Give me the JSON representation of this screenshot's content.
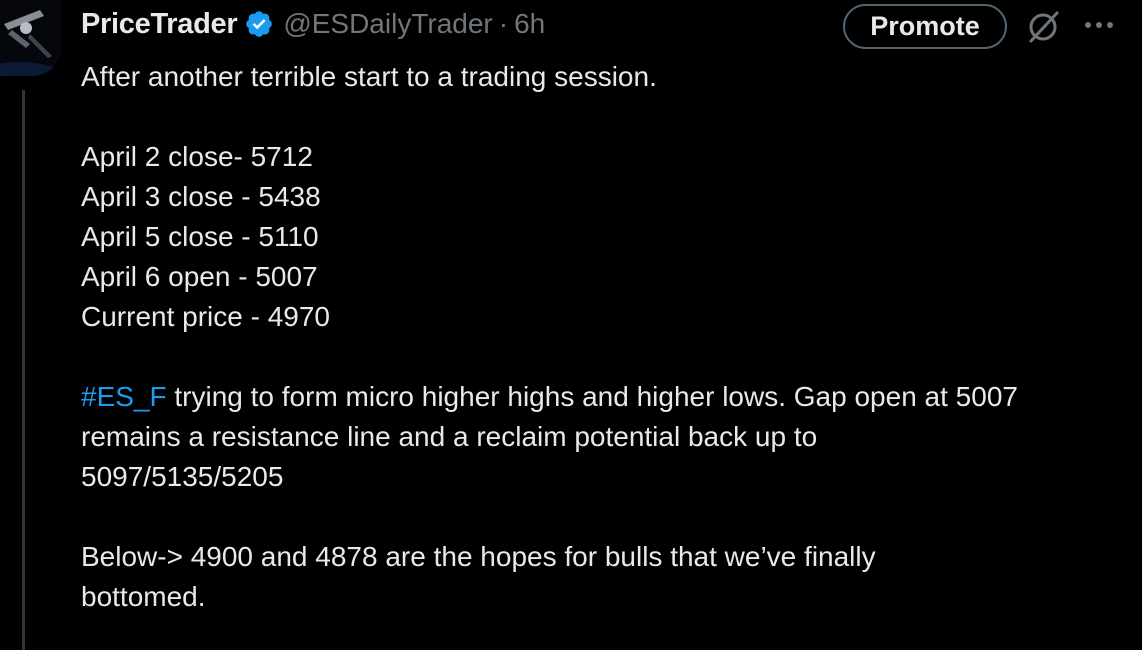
{
  "author": {
    "display_name": "PriceTrader",
    "handle": "@ESDailyTrader",
    "separator": "·",
    "time": "6h",
    "verified_icon": "verified-badge-icon"
  },
  "actions": {
    "promote_label": "Promote",
    "grok_icon": "grok-icon",
    "more_icon": "more-horizontal-icon"
  },
  "tweet": {
    "intro": "After another terrible start to a trading session.",
    "closes": [
      "April 2 close- 5712",
      "April 3 close - 5438",
      "April 5 close - 5110",
      "April 6 open - 5007",
      "Current price - 4970"
    ],
    "hashtag": "#ES_F",
    "analysis_line1_rest": " trying to form micro higher highs and higher lows. Gap open at 5007",
    "analysis_line2": "remains a resistance line and a reclaim potential back up to",
    "analysis_line3": "5097/5135/5205",
    "below_line1": "Below-> 4900 and 4878 are the hopes for bulls that we’ve finally",
    "below_line2": "bottomed."
  },
  "colors": {
    "background": "#000000",
    "text": "#e7e9ea",
    "muted": "#71767b",
    "link": "#1d9bf0",
    "verified": "#1d9bf0"
  }
}
